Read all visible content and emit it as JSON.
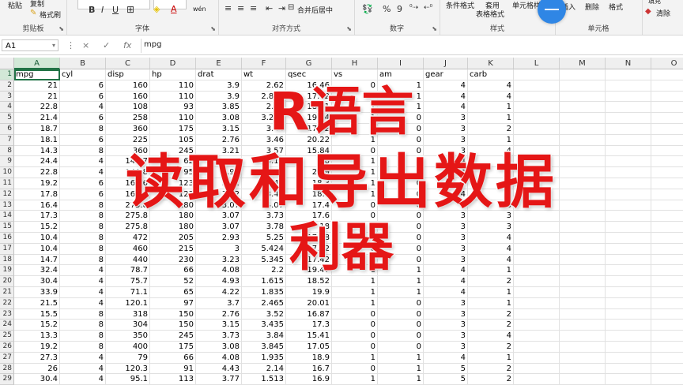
{
  "ribbon": {
    "clipboard": {
      "paste": "粘贴",
      "copy": "复制",
      "format_painter": "格式刷",
      "group_label": "剪贴板"
    },
    "font": {
      "bold": "B",
      "italic": "I",
      "underline": "U",
      "group_label": "字体",
      "font_color_letter": "A",
      "wen": "wén"
    },
    "alignment": {
      "merge_center": "合并后居中",
      "group_label": "对齐方式"
    },
    "number": {
      "percent": "%",
      "comma": "9",
      "group_label": "数字"
    },
    "styles": {
      "conditional_format": "条件格式",
      "table_format_line1": "套用",
      "table_format_line2": "表格格式",
      "cell_styles": "单元格样式",
      "group_label": "样式"
    },
    "cells": {
      "insert": "插入",
      "delete": "删除",
      "format": "格式",
      "group_label": "单元格"
    },
    "editing": {
      "clear": "清除",
      "fill": "填充"
    },
    "accent_color": "#2f86e5"
  },
  "formula_bar": {
    "name_box": "A1",
    "cancel_icon": "×",
    "enter_icon": "✓",
    "fx_label": "fx",
    "formula": "mpg"
  },
  "grid": {
    "columns": [
      "A",
      "B",
      "C",
      "D",
      "E",
      "F",
      "G",
      "H",
      "I",
      "J",
      "K",
      "L",
      "M",
      "N",
      "O"
    ],
    "rows": [
      "1",
      "2",
      "3",
      "4",
      "5",
      "6",
      "7",
      "8",
      "9",
      "10",
      "11",
      "12",
      "13",
      "14",
      "15",
      "16",
      "17",
      "18",
      "19",
      "20",
      "21",
      "22",
      "23",
      "24",
      "25",
      "26",
      "27",
      "28",
      "29"
    ],
    "headers": [
      "mpg",
      "cyl",
      "disp",
      "hp",
      "drat",
      "wt",
      "qsec",
      "vs",
      "am",
      "gear",
      "carb"
    ],
    "data": [
      [
        "21",
        "6",
        "160",
        "110",
        "3.9",
        "2.62",
        "16.46",
        "0",
        "1",
        "4",
        "4"
      ],
      [
        "21",
        "6",
        "160",
        "110",
        "3.9",
        "2.875",
        "17.02",
        "0",
        "1",
        "4",
        "4"
      ],
      [
        "22.8",
        "4",
        "108",
        "93",
        "3.85",
        "2.32",
        "18.61",
        "1",
        "1",
        "4",
        "1"
      ],
      [
        "21.4",
        "6",
        "258",
        "110",
        "3.08",
        "3.215",
        "19.44",
        "1",
        "0",
        "3",
        "1"
      ],
      [
        "18.7",
        "8",
        "360",
        "175",
        "3.15",
        "3.44",
        "17.02",
        "0",
        "0",
        "3",
        "2"
      ],
      [
        "18.1",
        "6",
        "225",
        "105",
        "2.76",
        "3.46",
        "20.22",
        "1",
        "0",
        "3",
        "1"
      ],
      [
        "14.3",
        "8",
        "360",
        "245",
        "3.21",
        "3.57",
        "15.84",
        "0",
        "0",
        "3",
        "4"
      ],
      [
        "24.4",
        "4",
        "146.7",
        "62",
        "3.69",
        "3.19",
        "20",
        "1",
        "0",
        "4",
        "2"
      ],
      [
        "22.8",
        "4",
        "140.8",
        "95",
        "3.92",
        "3.15",
        "22.9",
        "1",
        "0",
        "4",
        "2"
      ],
      [
        "19.2",
        "6",
        "167.6",
        "123",
        "3.92",
        "3.44",
        "18.3",
        "1",
        "0",
        "4",
        "4"
      ],
      [
        "17.8",
        "6",
        "167.6",
        "123",
        "3.92",
        "3.44",
        "18.9",
        "1",
        "0",
        "4",
        "4"
      ],
      [
        "16.4",
        "8",
        "275.8",
        "180",
        "3.07",
        "4.07",
        "17.4",
        "0",
        "0",
        "3",
        "3"
      ],
      [
        "17.3",
        "8",
        "275.8",
        "180",
        "3.07",
        "3.73",
        "17.6",
        "0",
        "0",
        "3",
        "3"
      ],
      [
        "15.2",
        "8",
        "275.8",
        "180",
        "3.07",
        "3.78",
        "18",
        "0",
        "0",
        "3",
        "3"
      ],
      [
        "10.4",
        "8",
        "472",
        "205",
        "2.93",
        "5.25",
        "17.98",
        "0",
        "0",
        "3",
        "4"
      ],
      [
        "10.4",
        "8",
        "460",
        "215",
        "3",
        "5.424",
        "17.82",
        "0",
        "0",
        "3",
        "4"
      ],
      [
        "14.7",
        "8",
        "440",
        "230",
        "3.23",
        "5.345",
        "17.42",
        "0",
        "0",
        "3",
        "4"
      ],
      [
        "32.4",
        "4",
        "78.7",
        "66",
        "4.08",
        "2.2",
        "19.47",
        "1",
        "1",
        "4",
        "1"
      ],
      [
        "30.4",
        "4",
        "75.7",
        "52",
        "4.93",
        "1.615",
        "18.52",
        "1",
        "1",
        "4",
        "2"
      ],
      [
        "33.9",
        "4",
        "71.1",
        "65",
        "4.22",
        "1.835",
        "19.9",
        "1",
        "1",
        "4",
        "1"
      ],
      [
        "21.5",
        "4",
        "120.1",
        "97",
        "3.7",
        "2.465",
        "20.01",
        "1",
        "0",
        "3",
        "1"
      ],
      [
        "15.5",
        "8",
        "318",
        "150",
        "2.76",
        "3.52",
        "16.87",
        "0",
        "0",
        "3",
        "2"
      ],
      [
        "15.2",
        "8",
        "304",
        "150",
        "3.15",
        "3.435",
        "17.3",
        "0",
        "0",
        "3",
        "2"
      ],
      [
        "13.3",
        "8",
        "350",
        "245",
        "3.73",
        "3.84",
        "15.41",
        "0",
        "0",
        "3",
        "4"
      ],
      [
        "19.2",
        "8",
        "400",
        "175",
        "3.08",
        "3.845",
        "17.05",
        "0",
        "0",
        "3",
        "2"
      ],
      [
        "27.3",
        "4",
        "79",
        "66",
        "4.08",
        "1.935",
        "18.9",
        "1",
        "1",
        "4",
        "1"
      ],
      [
        "26",
        "4",
        "120.3",
        "91",
        "4.43",
        "2.14",
        "16.7",
        "0",
        "1",
        "5",
        "2"
      ],
      [
        "30.4",
        "4",
        "95.1",
        "113",
        "3.77",
        "1.513",
        "16.9",
        "1",
        "1",
        "5",
        "2"
      ]
    ]
  },
  "overlay": {
    "line1": "R语言",
    "line2": "读取和导出数据",
    "line3": "利器",
    "color": "#e51616"
  }
}
